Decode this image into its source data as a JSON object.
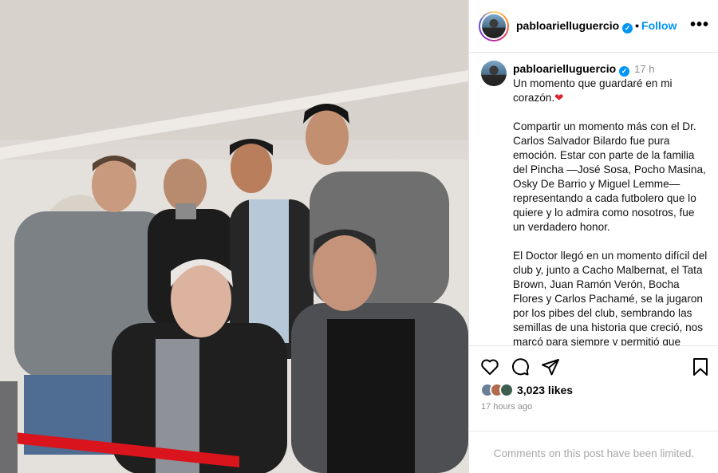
{
  "header": {
    "username": "pabloarielluguercio",
    "separator": "•",
    "follow_label": "Follow",
    "more_label": "•••"
  },
  "caption": {
    "username": "pabloarielluguercio",
    "time": "17 h",
    "paragraph1": "Un momento que guardaré en mi corazón.",
    "heart": "❤",
    "paragraph2": "Compartir un momento más con el Dr. Carlos Salvador Bilardo fue pura emoción. Estar con parte de la familia del Pincha —José Sosa, Pocho Masina, Osky De Barrio y Miguel Lemme— representando a cada futbolero que lo quiere y lo admira como nosotros, fue un verdadero honor.",
    "paragraph3": "El Doctor llegó en un momento difícil del club y, junto a Cacho Malbernat, el Tata Brown, Juan Ramón Verón, Bocha Flores y Carlos Pachamé, se la jugaron por los pibes del club, sembrando las semillas de una historia que creció, nos marcó para siempre y permitió que Estudiantes tenga hoy esta grandeza"
  },
  "actions": {
    "icons": [
      "heart-icon",
      "comment-icon",
      "share-icon",
      "bookmark-icon"
    ],
    "likes": "3,023 likes",
    "posted_ago": "17 hours ago",
    "comments_notice": "Comments on this post have been limited."
  },
  "colors": {
    "link_blue": "#0095f6",
    "heart_red": "#e0252f",
    "muted_gray": "#8e8e8e",
    "ribbon_red": "#d9141c"
  }
}
